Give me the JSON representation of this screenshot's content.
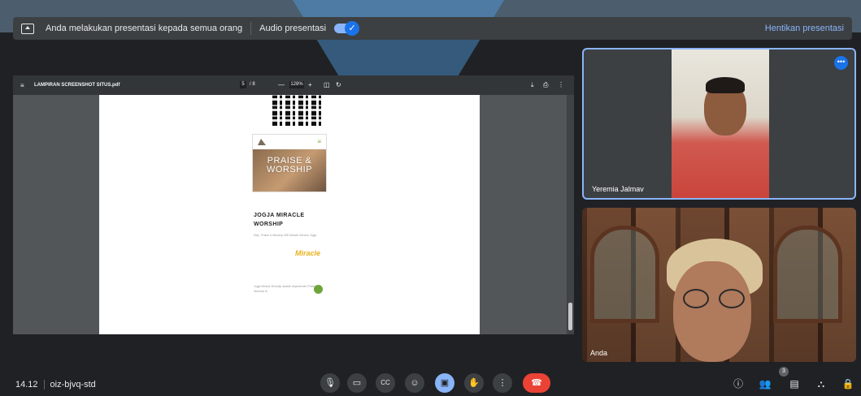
{
  "banner": {
    "presenting_text": "Anda melakukan presentasi kepada semua orang",
    "audio_label": "Audio presentasi",
    "toggle_check": "✓",
    "stop_label": "Hentikan presentasi"
  },
  "pdf": {
    "menu_icon": "≡",
    "file_name": "LAMPIRAN SCREENSHOT SITUS.pdf",
    "page_current": "5",
    "page_total": "/ 8",
    "zoom_out": "—",
    "zoom_level": "128%",
    "zoom_in": "+",
    "fit_icon": "◫",
    "rotate_icon": "↻",
    "download_icon": "⤓",
    "print_icon": "⎙",
    "more_icon": "⋮"
  },
  "document": {
    "hero_text": "PRAISE & WORSHIP",
    "title_line1": "JOGJA MIRACLE",
    "title_line2": "WORSHIP",
    "subtitle": "Sepi, Praise & Worship GBI Miracle Service Jogja",
    "logo_text": "Miracle",
    "footer_text": "Jogja Miracle Worship adalah departemen Praise & Worship di"
  },
  "participants": [
    {
      "name": "Yeremia Jalmav"
    },
    {
      "name": "Anda"
    }
  ],
  "meeting": {
    "time": "14.12",
    "code": "oiz-bjvq-std",
    "participant_count": "3"
  },
  "controls": {
    "mic_icon": "🎙",
    "camera_icon": "▭",
    "captions_icon": "CC",
    "emoji_icon": "☺",
    "present_icon": "▣",
    "raise_hand_icon": "✋",
    "more_icon": "⋮",
    "end_call_icon": "☎"
  },
  "side_controls": {
    "info_icon": "ⓘ",
    "people_icon": "👥",
    "chat_icon": "▤",
    "activities_icon": "⛬",
    "lock_icon": "🔒"
  },
  "colors": {
    "background": "#202124",
    "accent": "#8ab4f8",
    "end_call": "#ea4335",
    "watermark": "#a0d2f5"
  }
}
